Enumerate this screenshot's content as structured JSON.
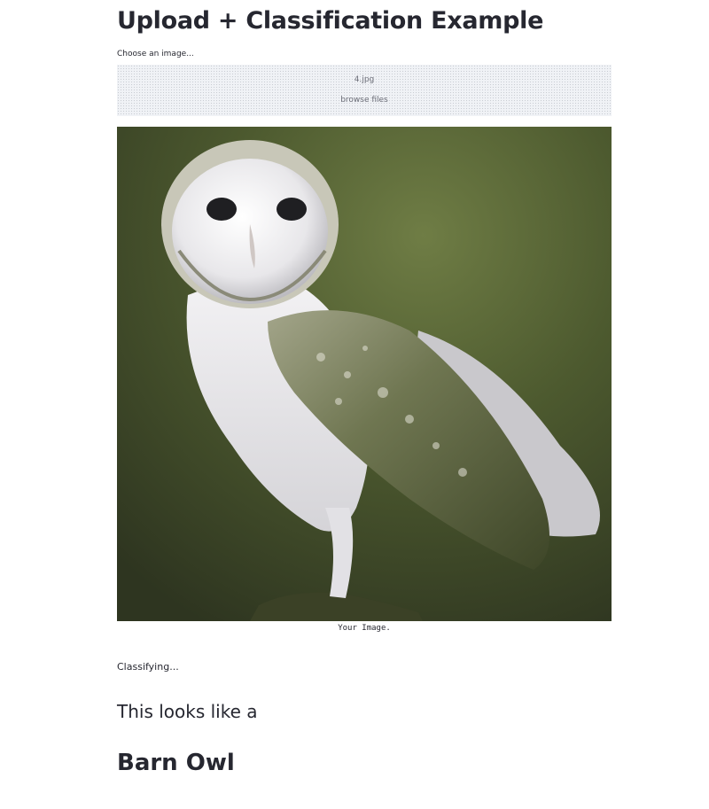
{
  "page": {
    "title": "Upload + Classification Example"
  },
  "uploader": {
    "label": "Choose an image...",
    "file_name": "4.jpg",
    "browse_label": "browse files"
  },
  "image": {
    "caption": "Your Image."
  },
  "result": {
    "status": "Classifying...",
    "intro": "This looks like a",
    "prediction": "Barn Owl"
  },
  "colors": {
    "text": "#262730",
    "dropzone_bg": "#f0f2f6",
    "background": "#ffffff"
  }
}
